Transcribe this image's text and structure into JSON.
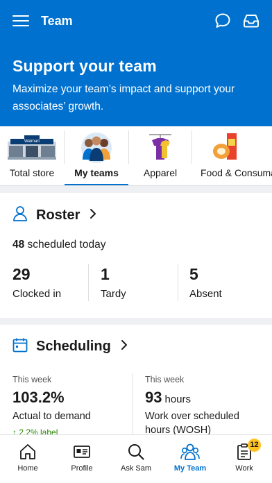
{
  "header": {
    "title": "Team"
  },
  "hero": {
    "title": "Support your team",
    "subtitle": "Maximize your team’s impact and support your associates’ growth."
  },
  "categories": [
    {
      "label": "Total store",
      "icon": "store-icon"
    },
    {
      "label": "My teams",
      "icon": "team-people-icon",
      "active": true
    },
    {
      "label": "Apparel",
      "icon": "apparel-icon"
    },
    {
      "label": "Food & Consuma",
      "icon": "food-icon"
    }
  ],
  "roster": {
    "title": "Roster",
    "scheduled_count": "48",
    "scheduled_text": " scheduled today",
    "stats": [
      {
        "value": "29",
        "label": "Clocked in"
      },
      {
        "value": "1",
        "label": "Tardy"
      },
      {
        "value": "5",
        "label": "Absent"
      }
    ]
  },
  "scheduling": {
    "title": "Scheduling",
    "left": {
      "period": "This week",
      "value": "103.2%",
      "description": "Actual to demand",
      "trend": "↑ 2.2% label"
    },
    "right": {
      "period": "This week",
      "value": "93",
      "unit": "hours",
      "description_line1": "Work over scheduled",
      "description_line2": "hours (WOSH)"
    }
  },
  "tabbar": {
    "tabs": [
      {
        "label": "Home",
        "icon": "home-icon"
      },
      {
        "label": "Profile",
        "icon": "profile-card-icon"
      },
      {
        "label": "Ask Sam",
        "icon": "search-icon"
      },
      {
        "label": "My Team",
        "icon": "team-icon",
        "active": true
      },
      {
        "label": "Work",
        "icon": "clipboard-icon",
        "badge": "12"
      }
    ]
  },
  "colors": {
    "brand_blue": "#0071ce",
    "badge_yellow": "#ffc220",
    "trend_green": "#2a8703"
  }
}
